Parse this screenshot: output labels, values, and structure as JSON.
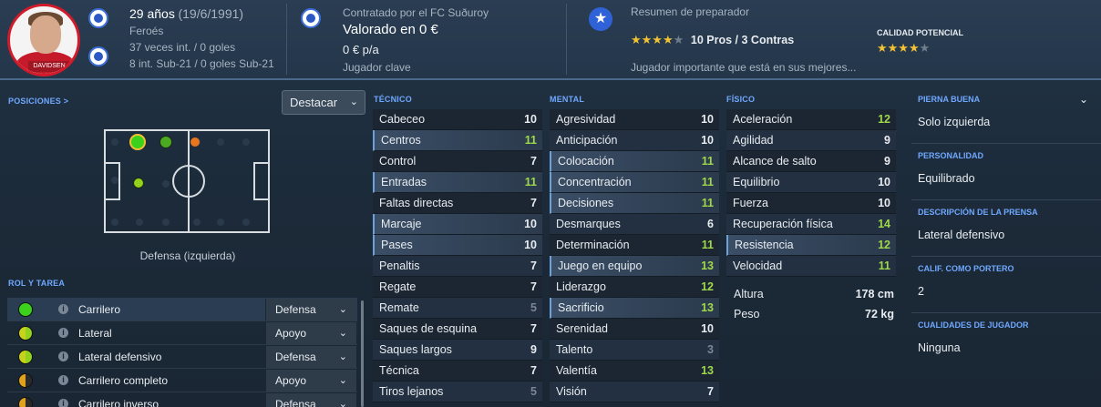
{
  "player": {
    "age_text": "29 años",
    "dob": "(19/6/1991)",
    "nationality": "Feroés",
    "caps": "37 veces int. / 0 goles",
    "u21": "8 int. Sub-21 / 0 goles Sub-21",
    "shirt_name": "DAVIDSEN"
  },
  "contract": {
    "club": "Contratado por el FC Suðuroy",
    "valuation": "Valorado en 0 €",
    "wage": "0 € p/a",
    "status": "Jugador clave"
  },
  "scout": {
    "title": "Resumen de preparador",
    "pros_cons": "10 Pros / 3 Contras",
    "current_stars": 4.5,
    "potential_label": "CALIDAD POTENCIAL",
    "potential_stars": 4.5,
    "summary": "Jugador importante que está en sus mejores..."
  },
  "positions": {
    "title": "POSICIONES >",
    "dropdown": "Destacar",
    "label": "Defensa (izquierda)"
  },
  "roles": {
    "title": "ROL Y TAREA",
    "items": [
      {
        "name": "Carrilero",
        "duty": "Defensa",
        "color": "#3cd21c"
      },
      {
        "name": "Lateral",
        "duty": "Apoyo",
        "color": "#93d21c"
      },
      {
        "name": "Lateral defensivo",
        "duty": "Defensa",
        "color": "#93d21c"
      },
      {
        "name": "Carrilero completo",
        "duty": "Apoyo",
        "color": "#e0a11c"
      },
      {
        "name": "Carrilero inverso",
        "duty": "Defensa",
        "color": "#e0a11c"
      }
    ]
  },
  "tecnico": {
    "title": "TÉCNICO",
    "rows": [
      {
        "name": "Cabeceo",
        "value": "10",
        "hl": false,
        "tone": ""
      },
      {
        "name": "Centros",
        "value": "11",
        "hl": true,
        "tone": "green"
      },
      {
        "name": "Control",
        "value": "7",
        "hl": false,
        "tone": ""
      },
      {
        "name": "Entradas",
        "value": "11",
        "hl": true,
        "tone": "green"
      },
      {
        "name": "Faltas directas",
        "value": "7",
        "hl": false,
        "tone": ""
      },
      {
        "name": "Marcaje",
        "value": "10",
        "hl": true,
        "tone": ""
      },
      {
        "name": "Pases",
        "value": "10",
        "hl": true,
        "tone": ""
      },
      {
        "name": "Penaltis",
        "value": "7",
        "hl": false,
        "tone": ""
      },
      {
        "name": "Regate",
        "value": "7",
        "hl": false,
        "tone": ""
      },
      {
        "name": "Remate",
        "value": "5",
        "hl": false,
        "tone": "grey"
      },
      {
        "name": "Saques de esquina",
        "value": "7",
        "hl": false,
        "tone": ""
      },
      {
        "name": "Saques largos",
        "value": "9",
        "hl": false,
        "tone": ""
      },
      {
        "name": "Técnica",
        "value": "7",
        "hl": false,
        "tone": ""
      },
      {
        "name": "Tiros lejanos",
        "value": "5",
        "hl": false,
        "tone": "grey"
      }
    ]
  },
  "mental": {
    "title": "MENTAL",
    "rows": [
      {
        "name": "Agresividad",
        "value": "10",
        "hl": false,
        "tone": ""
      },
      {
        "name": "Anticipación",
        "value": "10",
        "hl": false,
        "tone": ""
      },
      {
        "name": "Colocación",
        "value": "11",
        "hl": true,
        "tone": "green"
      },
      {
        "name": "Concentración",
        "value": "11",
        "hl": true,
        "tone": "green"
      },
      {
        "name": "Decisiones",
        "value": "11",
        "hl": true,
        "tone": "green"
      },
      {
        "name": "Desmarques",
        "value": "6",
        "hl": false,
        "tone": ""
      },
      {
        "name": "Determinación",
        "value": "11",
        "hl": false,
        "tone": "green"
      },
      {
        "name": "Juego en equipo",
        "value": "13",
        "hl": true,
        "tone": "green"
      },
      {
        "name": "Liderazgo",
        "value": "12",
        "hl": false,
        "tone": "green"
      },
      {
        "name": "Sacrificio",
        "value": "13",
        "hl": true,
        "tone": "green"
      },
      {
        "name": "Serenidad",
        "value": "10",
        "hl": false,
        "tone": ""
      },
      {
        "name": "Talento",
        "value": "3",
        "hl": false,
        "tone": "grey"
      },
      {
        "name": "Valentía",
        "value": "13",
        "hl": false,
        "tone": "green"
      },
      {
        "name": "Visión",
        "value": "7",
        "hl": false,
        "tone": ""
      }
    ]
  },
  "fisico": {
    "title": "FÍSICO",
    "rows": [
      {
        "name": "Aceleración",
        "value": "12",
        "hl": false,
        "tone": "green"
      },
      {
        "name": "Agilidad",
        "value": "9",
        "hl": false,
        "tone": ""
      },
      {
        "name": "Alcance de salto",
        "value": "9",
        "hl": false,
        "tone": ""
      },
      {
        "name": "Equilibrio",
        "value": "10",
        "hl": false,
        "tone": ""
      },
      {
        "name": "Fuerza",
        "value": "10",
        "hl": false,
        "tone": ""
      },
      {
        "name": "Recuperación física",
        "value": "14",
        "hl": false,
        "tone": "green"
      },
      {
        "name": "Resistencia",
        "value": "12",
        "hl": true,
        "tone": "green"
      },
      {
        "name": "Velocidad",
        "value": "11",
        "hl": false,
        "tone": "green"
      }
    ],
    "height_label": "Altura",
    "height_value": "178 cm",
    "weight_label": "Peso",
    "weight_value": "72 kg"
  },
  "right": {
    "pie_label": "PIERNA BUENA",
    "pie_value": "Solo izquierda",
    "personality_label": "PERSONALIDAD",
    "personality_value": "Equilibrado",
    "press_label": "DESCRIPCIÓN DE LA PRENSA",
    "press_value": "Lateral defensivo",
    "gk_label": "CALIF. COMO PORTERO",
    "gk_value": "2",
    "qualities_label": "CUALIDADES DE JUGADOR",
    "qualities_value": "Ninguna"
  }
}
